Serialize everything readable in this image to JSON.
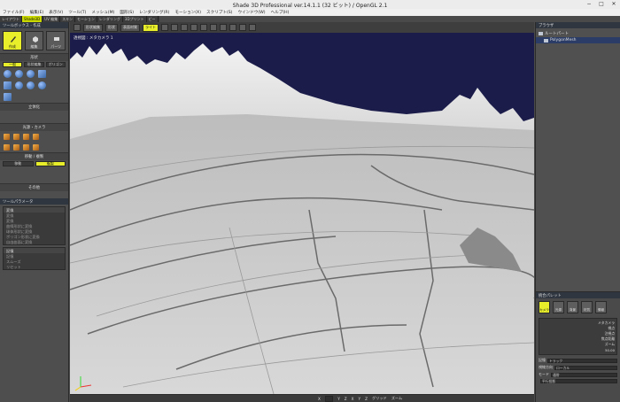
{
  "app": {
    "title": "Shade 3D Professional ver.14.1.1 (32 ビット) / OpenGL 2.1",
    "window_controls": [
      "−",
      "□",
      "✕"
    ]
  },
  "menu": [
    "ファイル(F)",
    "編集(E)",
    "表示(V)",
    "ツール(T)",
    "メッシュ(M)",
    "図形(S)",
    "レンダリング(R)",
    "モーション(X)",
    "スクリプト(S)",
    "ウインドウ(W)",
    "ヘルプ(H)"
  ],
  "workspace_tabs": [
    "レイアウト",
    "Shade3D",
    "UV 編集",
    "スキン",
    "モーション",
    "レンダリング",
    "3Dプリント",
    "ビー"
  ],
  "workspace_active": 1,
  "left_panel": {
    "header": "ツールボックス - 作成",
    "mode_tabs": [
      "作成",
      "編集",
      "パーツ"
    ],
    "section_form": "形状",
    "form_buttons": [
      "一般",
      "形状編集",
      "ポリゴン"
    ],
    "section_solid": "立体化",
    "section_mirror": "光源・カメラ",
    "section_move": "移動 / 複製",
    "move_buttons": [
      "移動",
      "複製"
    ],
    "section_bottom": "その他",
    "tool_param_header": "ツールパラメータ",
    "list_header": "変換",
    "list_items": [
      "変換",
      "変換",
      "曲線形状に変換",
      "球体形状に変換",
      "ポリゴン形状に変換",
      "自由曲面に変換"
    ],
    "list2_header": "記憶",
    "list2_items": [
      "記憶",
      "スムーズ",
      "リセット"
    ]
  },
  "viewport": {
    "buttons": [
      "形状編集",
      "形状",
      "表面材質",
      "ライト"
    ],
    "camera_label": "透視図 : メタカメラ 1",
    "sky_color": "#1b1c4a"
  },
  "right_panel": {
    "header": "ブラウザ",
    "tree": [
      "ルートパート",
      "PolygonMesh"
    ],
    "tree_selected": 1,
    "section_header": "統合パレット",
    "icons": [
      "カメラ",
      "光源",
      "背景",
      "材質",
      "情報"
    ],
    "active_icon": 0,
    "options": [
      "メタカメラ",
      "視点",
      "注視点",
      "焦点距離",
      "ズーム"
    ],
    "zoom_label": "ズーム",
    "zoom_value": "50.00",
    "rows": [
      {
        "label": "記憶",
        "value": "トラック"
      },
      {
        "label": "視線方向",
        "value": "ローカル"
      },
      {
        "label": "モード",
        "value": "通常"
      },
      {
        "label": "",
        "value": "平行投影"
      }
    ]
  },
  "status": [
    "X",
    "Y",
    "Z",
    "X",
    "Y",
    "Z",
    "グリッド",
    "ズーム"
  ]
}
